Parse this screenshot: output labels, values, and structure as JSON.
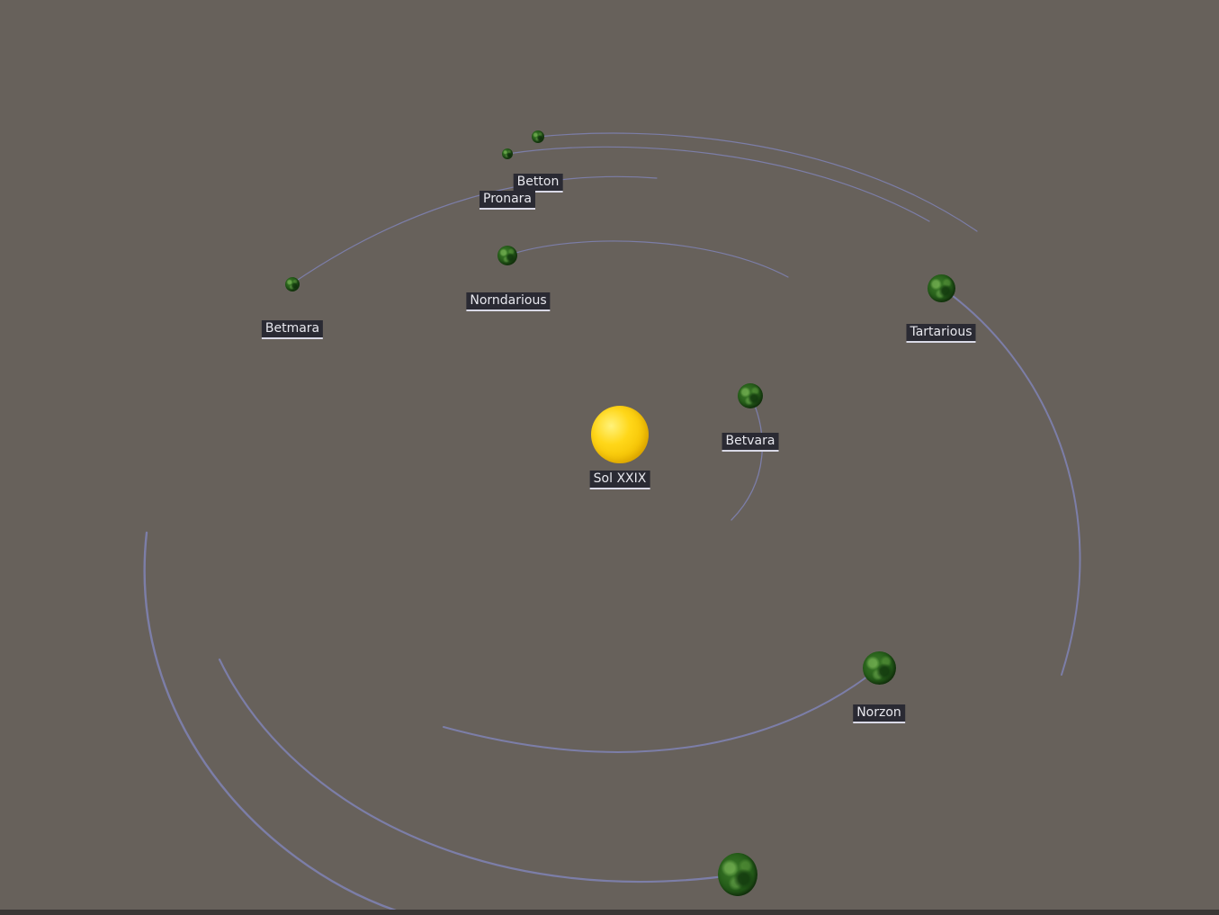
{
  "scene": {
    "background": "#67615b",
    "orbit_color": "#7c7ea8",
    "label_background": "#2a2a33",
    "label_text_color": "#e8e8ee"
  },
  "star": {
    "name": "Sol XXIX",
    "color": "#ffd719"
  },
  "planets": [
    {
      "name": "Betton"
    },
    {
      "name": "Pronara"
    },
    {
      "name": "Norndarious"
    },
    {
      "name": "Betmara"
    },
    {
      "name": "Tartarious"
    },
    {
      "name": "Betvara"
    },
    {
      "name": "Norzon"
    }
  ]
}
